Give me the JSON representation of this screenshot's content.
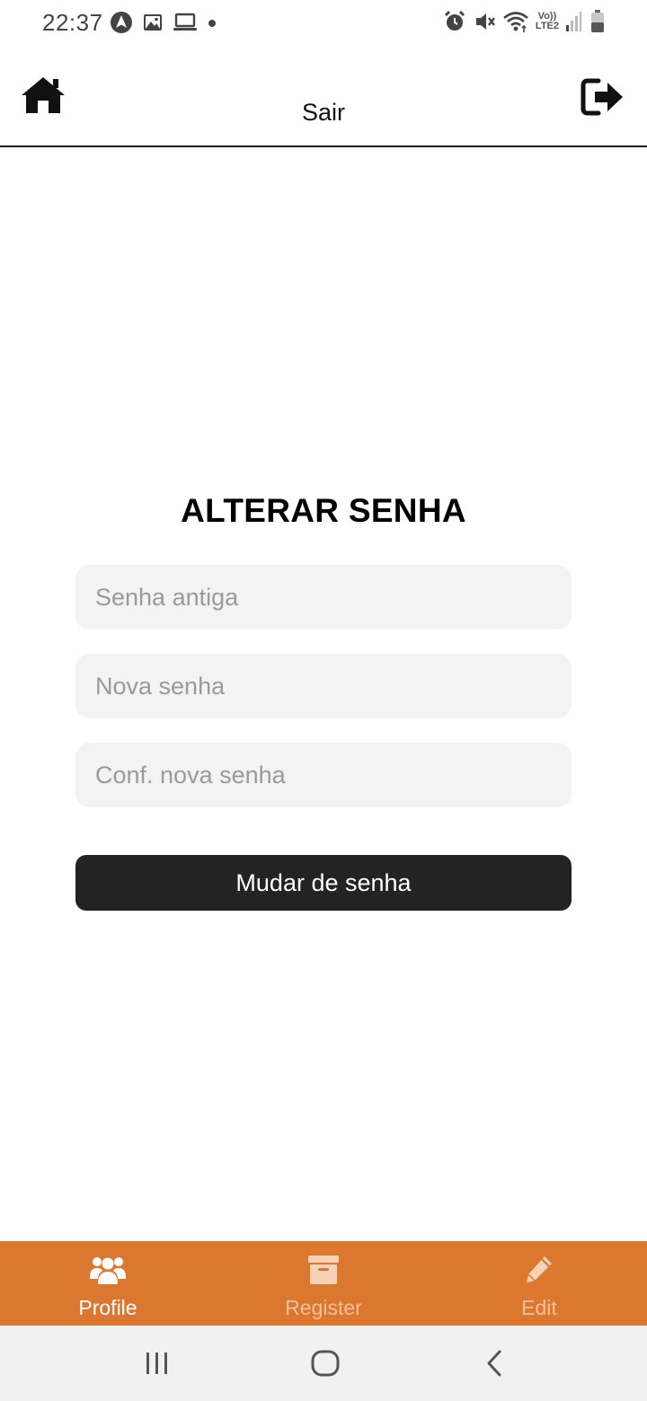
{
  "status_bar": {
    "time": "22:37",
    "left_icons": [
      "navigation-arrow-icon",
      "image-icon",
      "laptop-icon",
      "dot-icon"
    ],
    "right_icons": [
      "alarm-icon",
      "vibrate-mute-icon",
      "wifi-icon",
      "volte-icon",
      "signal-icon",
      "battery-icon"
    ],
    "volte_line1": "Vo))",
    "volte_line2": "LTE2"
  },
  "header": {
    "home_icon": "home-icon",
    "title": "Sair",
    "logout_icon": "logout-icon"
  },
  "form": {
    "title": "ALTERAR SENHA",
    "old_password": {
      "placeholder": "Senha antiga",
      "value": ""
    },
    "new_password": {
      "placeholder": "Nova senha",
      "value": ""
    },
    "confirm_password": {
      "placeholder": "Conf. nova senha",
      "value": ""
    },
    "submit_label": "Mudar de senha"
  },
  "tab_bar": {
    "background": "#db772f",
    "active_color": "#ffffff",
    "inactive_color": "#f3c19b",
    "tabs": [
      {
        "label": "Profile",
        "icon": "users-icon",
        "active": true
      },
      {
        "label": "Register",
        "icon": "archive-box-icon",
        "active": false
      },
      {
        "label": "Edit",
        "icon": "pencil-icon",
        "active": false
      }
    ]
  },
  "system_nav": {
    "buttons": [
      "recents-icon",
      "home-circle-icon",
      "back-chevron-icon"
    ]
  }
}
